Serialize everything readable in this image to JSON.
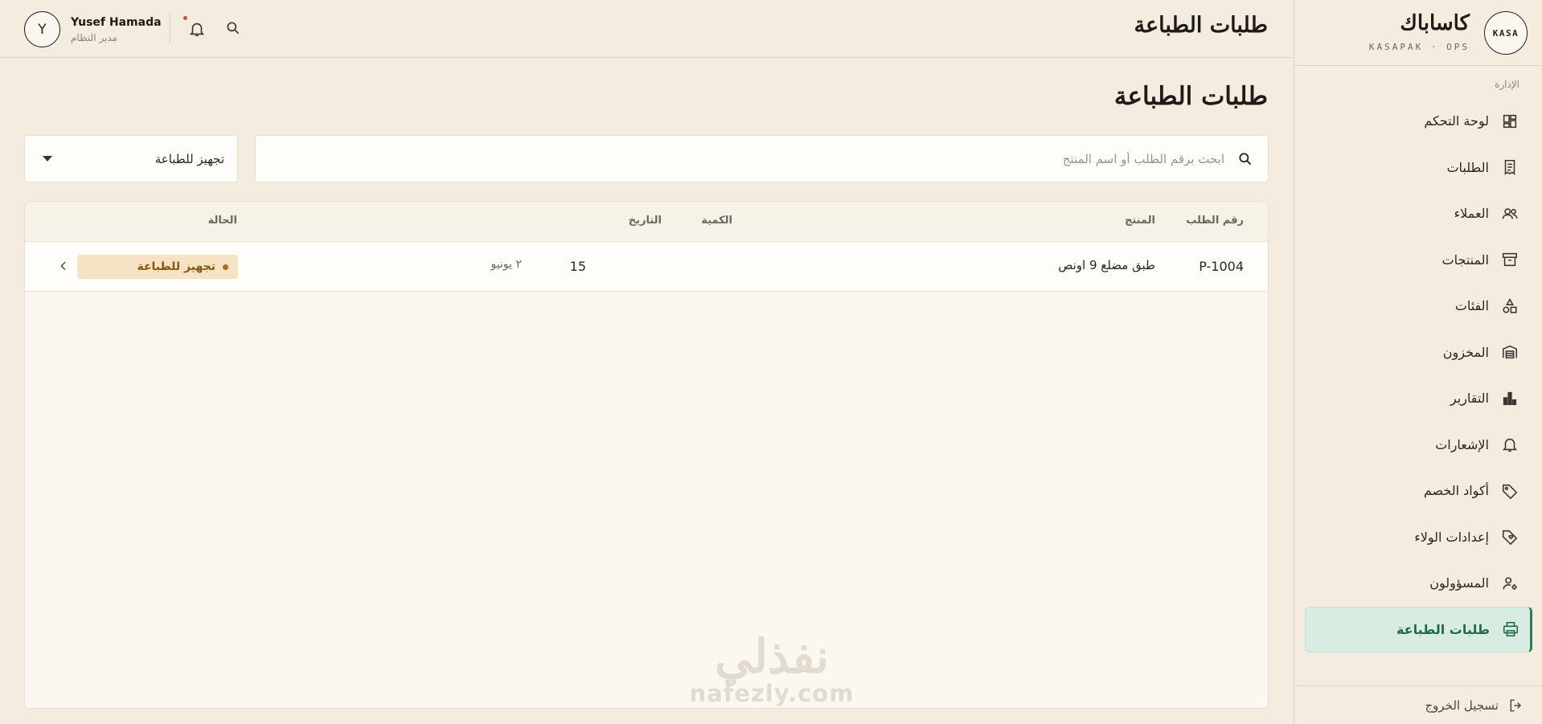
{
  "brand": {
    "logo_text": "KASA",
    "name_ar": "كاساباك",
    "subtitle": "KASAPAK · OPS"
  },
  "sidebar": {
    "section_label": "الإدارة",
    "items": [
      {
        "label": "لوحة التحكم",
        "icon": "dashboard-icon"
      },
      {
        "label": "الطلبات",
        "icon": "receipt-icon"
      },
      {
        "label": "العملاء",
        "icon": "users-icon"
      },
      {
        "label": "المنتجات",
        "icon": "archive-box-icon"
      },
      {
        "label": "الفئات",
        "icon": "shapes-icon"
      },
      {
        "label": "المخزون",
        "icon": "warehouse-icon"
      },
      {
        "label": "التقارير",
        "icon": "bar-chart-icon"
      },
      {
        "label": "الإشعارات",
        "icon": "bell-icon"
      },
      {
        "label": "أكواد الخصم",
        "icon": "tag-icon"
      },
      {
        "label": "إعدادات الولاء",
        "icon": "loyalty-tag-icon"
      },
      {
        "label": "المسؤولون",
        "icon": "admin-user-icon"
      },
      {
        "label": "طلبات الطباعة",
        "icon": "printer-icon",
        "active": true
      }
    ],
    "logout_label": "تسجيل الخروج"
  },
  "header": {
    "title": "طلبات الطباعة",
    "user_name": "Yusef Hamada",
    "user_role": "مدير النظام",
    "avatar_initial": "Y"
  },
  "main": {
    "title": "طلبات الطباعة",
    "search_placeholder": "ابحث برقم الطلب أو اسم المنتج",
    "status_filter": "تجهيز للطباعة",
    "table": {
      "columns": [
        "رقم الطلب",
        "المنتج",
        "الكمية",
        "التاريخ",
        "الحالة"
      ],
      "rows": [
        {
          "order_id": "P-1004",
          "product": "طبق مضلع 9 اونص",
          "quantity": "15",
          "date": "٢ يونيو",
          "status": "تجهيز للطباعة"
        }
      ]
    }
  },
  "watermark": {
    "arabic": "نفذلي",
    "latin": "nafezly.com"
  },
  "colors": {
    "background": "#f3ecdf",
    "active_nav": "#d9ece2",
    "active_accent": "#2f7a57",
    "status_badge": "#f6e3c3",
    "status_text": "#8a560d",
    "notification_dot": "#d0523a"
  }
}
